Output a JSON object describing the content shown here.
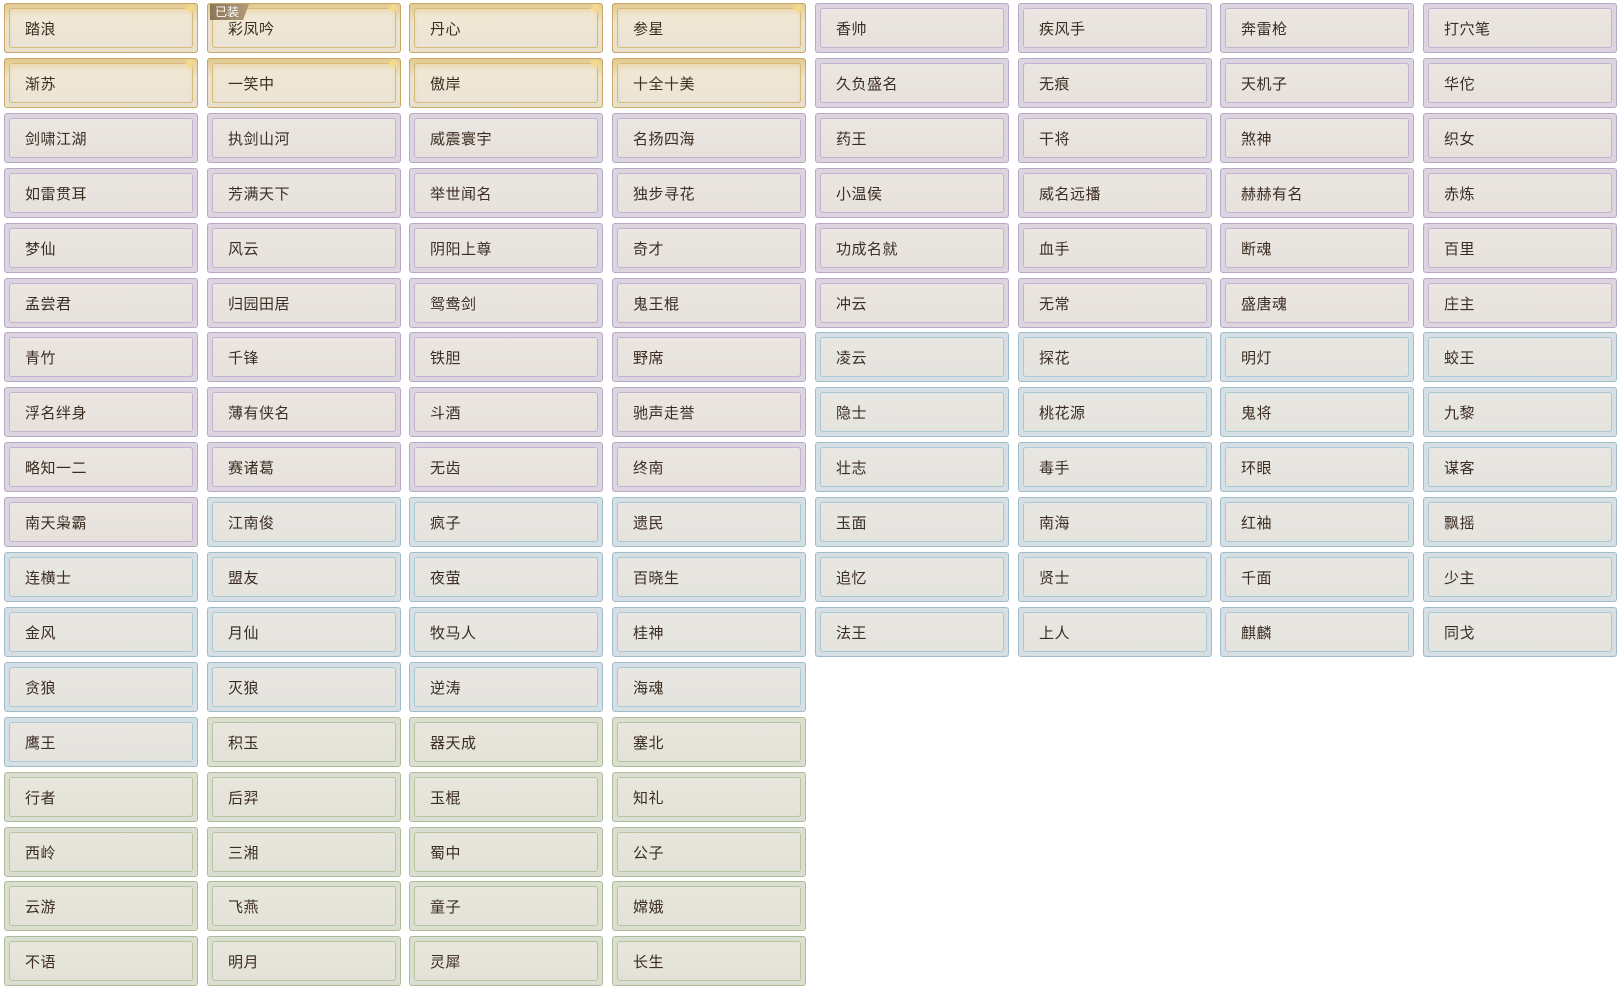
{
  "badge_equipped": "已装",
  "rarity_colors": {
    "gold": "#c9a764",
    "purple": "#b7a9c6",
    "blue": "#9fbccb",
    "green": "#aebb98"
  },
  "sparkle_icon": "sparkle-icon",
  "titles": [
    [
      {
        "label": "踏浪",
        "rarity": "gold",
        "sparkle": true
      },
      {
        "label": "彩凤吟",
        "rarity": "gold",
        "sparkle": true,
        "equipped": true
      },
      {
        "label": "丹心",
        "rarity": "gold",
        "sparkle": true
      },
      {
        "label": "参星",
        "rarity": "gold",
        "sparkle": true
      },
      {
        "label": "香帅",
        "rarity": "purple"
      },
      {
        "label": "疾风手",
        "rarity": "purple"
      },
      {
        "label": "奔雷枪",
        "rarity": "purple"
      },
      {
        "label": "打穴笔",
        "rarity": "purple"
      }
    ],
    [
      {
        "label": "渐苏",
        "rarity": "gold",
        "sparkle": true
      },
      {
        "label": "一笑中",
        "rarity": "gold",
        "sparkle": true
      },
      {
        "label": "傲岸",
        "rarity": "gold",
        "sparkle": true
      },
      {
        "label": "十全十美",
        "rarity": "gold"
      },
      {
        "label": "久负盛名",
        "rarity": "purple"
      },
      {
        "label": "无痕",
        "rarity": "purple"
      },
      {
        "label": "天机子",
        "rarity": "purple"
      },
      {
        "label": "华佗",
        "rarity": "purple"
      }
    ],
    [
      {
        "label": "剑啸江湖",
        "rarity": "purple"
      },
      {
        "label": "执剑山河",
        "rarity": "purple"
      },
      {
        "label": "威震寰宇",
        "rarity": "purple"
      },
      {
        "label": "名扬四海",
        "rarity": "purple"
      },
      {
        "label": "药王",
        "rarity": "purple"
      },
      {
        "label": "干将",
        "rarity": "purple"
      },
      {
        "label": "煞神",
        "rarity": "purple"
      },
      {
        "label": "织女",
        "rarity": "purple"
      }
    ],
    [
      {
        "label": "如雷贯耳",
        "rarity": "purple"
      },
      {
        "label": "芳满天下",
        "rarity": "purple"
      },
      {
        "label": "举世闻名",
        "rarity": "purple"
      },
      {
        "label": "独步寻花",
        "rarity": "purple"
      },
      {
        "label": "小温侯",
        "rarity": "purple"
      },
      {
        "label": "威名远播",
        "rarity": "purple"
      },
      {
        "label": "赫赫有名",
        "rarity": "purple"
      },
      {
        "label": "赤炼",
        "rarity": "purple"
      }
    ],
    [
      {
        "label": "梦仙",
        "rarity": "purple"
      },
      {
        "label": "风云",
        "rarity": "purple"
      },
      {
        "label": "阴阳上尊",
        "rarity": "purple"
      },
      {
        "label": "奇才",
        "rarity": "purple"
      },
      {
        "label": "功成名就",
        "rarity": "purple"
      },
      {
        "label": "血手",
        "rarity": "purple"
      },
      {
        "label": "断魂",
        "rarity": "purple"
      },
      {
        "label": "百里",
        "rarity": "purple"
      }
    ],
    [
      {
        "label": "孟尝君",
        "rarity": "purple"
      },
      {
        "label": "归园田居",
        "rarity": "purple"
      },
      {
        "label": "鸳鸯剑",
        "rarity": "purple"
      },
      {
        "label": "鬼王棍",
        "rarity": "purple"
      },
      {
        "label": "冲云",
        "rarity": "purple"
      },
      {
        "label": "无常",
        "rarity": "purple"
      },
      {
        "label": "盛唐魂",
        "rarity": "purple"
      },
      {
        "label": "庄主",
        "rarity": "purple"
      }
    ],
    [
      {
        "label": "青竹",
        "rarity": "purple"
      },
      {
        "label": "千锋",
        "rarity": "purple"
      },
      {
        "label": "铁胆",
        "rarity": "purple"
      },
      {
        "label": "野席",
        "rarity": "purple"
      },
      {
        "label": "凌云",
        "rarity": "blue"
      },
      {
        "label": "探花",
        "rarity": "blue"
      },
      {
        "label": "明灯",
        "rarity": "blue"
      },
      {
        "label": "蛟王",
        "rarity": "blue"
      }
    ],
    [
      {
        "label": "浮名绊身",
        "rarity": "purple"
      },
      {
        "label": "薄有侠名",
        "rarity": "purple"
      },
      {
        "label": "斗酒",
        "rarity": "purple"
      },
      {
        "label": "驰声走誉",
        "rarity": "purple"
      },
      {
        "label": "隐士",
        "rarity": "blue"
      },
      {
        "label": "桃花源",
        "rarity": "blue"
      },
      {
        "label": "鬼将",
        "rarity": "blue"
      },
      {
        "label": "九黎",
        "rarity": "blue"
      }
    ],
    [
      {
        "label": "略知一二",
        "rarity": "purple"
      },
      {
        "label": "赛诸葛",
        "rarity": "purple"
      },
      {
        "label": "无齿",
        "rarity": "purple"
      },
      {
        "label": "终南",
        "rarity": "purple"
      },
      {
        "label": "壮志",
        "rarity": "blue"
      },
      {
        "label": "毒手",
        "rarity": "blue"
      },
      {
        "label": "环眼",
        "rarity": "blue"
      },
      {
        "label": "谋客",
        "rarity": "blue"
      }
    ],
    [
      {
        "label": "南天枭霸",
        "rarity": "purple"
      },
      {
        "label": "江南俊",
        "rarity": "blue"
      },
      {
        "label": "疯子",
        "rarity": "blue"
      },
      {
        "label": "遗民",
        "rarity": "blue"
      },
      {
        "label": "玉面",
        "rarity": "blue"
      },
      {
        "label": "南海",
        "rarity": "blue"
      },
      {
        "label": "红袖",
        "rarity": "blue"
      },
      {
        "label": "飘摇",
        "rarity": "blue"
      }
    ],
    [
      {
        "label": "连横士",
        "rarity": "blue"
      },
      {
        "label": "盟友",
        "rarity": "blue"
      },
      {
        "label": "夜萤",
        "rarity": "blue"
      },
      {
        "label": "百晓生",
        "rarity": "blue"
      },
      {
        "label": "追忆",
        "rarity": "blue"
      },
      {
        "label": "贤士",
        "rarity": "blue"
      },
      {
        "label": "千面",
        "rarity": "blue"
      },
      {
        "label": "少主",
        "rarity": "blue"
      }
    ],
    [
      {
        "label": "金风",
        "rarity": "blue"
      },
      {
        "label": "月仙",
        "rarity": "blue"
      },
      {
        "label": "牧马人",
        "rarity": "blue"
      },
      {
        "label": "桂神",
        "rarity": "blue"
      },
      {
        "label": "法王",
        "rarity": "blue"
      },
      {
        "label": "上人",
        "rarity": "blue"
      },
      {
        "label": "麒麟",
        "rarity": "blue"
      },
      {
        "label": "同戈",
        "rarity": "blue"
      }
    ],
    [
      {
        "label": "贪狼",
        "rarity": "blue"
      },
      {
        "label": "灭狼",
        "rarity": "blue"
      },
      {
        "label": "逆涛",
        "rarity": "blue"
      },
      {
        "label": "海魂",
        "rarity": "blue"
      }
    ],
    [
      {
        "label": "鹰王",
        "rarity": "blue"
      },
      {
        "label": "积玉",
        "rarity": "green"
      },
      {
        "label": "器天成",
        "rarity": "green"
      },
      {
        "label": "塞北",
        "rarity": "green"
      }
    ],
    [
      {
        "label": "行者",
        "rarity": "green"
      },
      {
        "label": "后羿",
        "rarity": "green"
      },
      {
        "label": "玉棍",
        "rarity": "green"
      },
      {
        "label": "知礼",
        "rarity": "green"
      }
    ],
    [
      {
        "label": "西岭",
        "rarity": "green"
      },
      {
        "label": "三湘",
        "rarity": "green"
      },
      {
        "label": "蜀中",
        "rarity": "green"
      },
      {
        "label": "公子",
        "rarity": "green"
      }
    ],
    [
      {
        "label": "云游",
        "rarity": "green"
      },
      {
        "label": "飞燕",
        "rarity": "green"
      },
      {
        "label": "童子",
        "rarity": "green"
      },
      {
        "label": "嫦娥",
        "rarity": "green"
      }
    ],
    [
      {
        "label": "不语",
        "rarity": "green"
      },
      {
        "label": "明月",
        "rarity": "green"
      },
      {
        "label": "灵犀",
        "rarity": "green"
      },
      {
        "label": "长生",
        "rarity": "green"
      }
    ]
  ]
}
